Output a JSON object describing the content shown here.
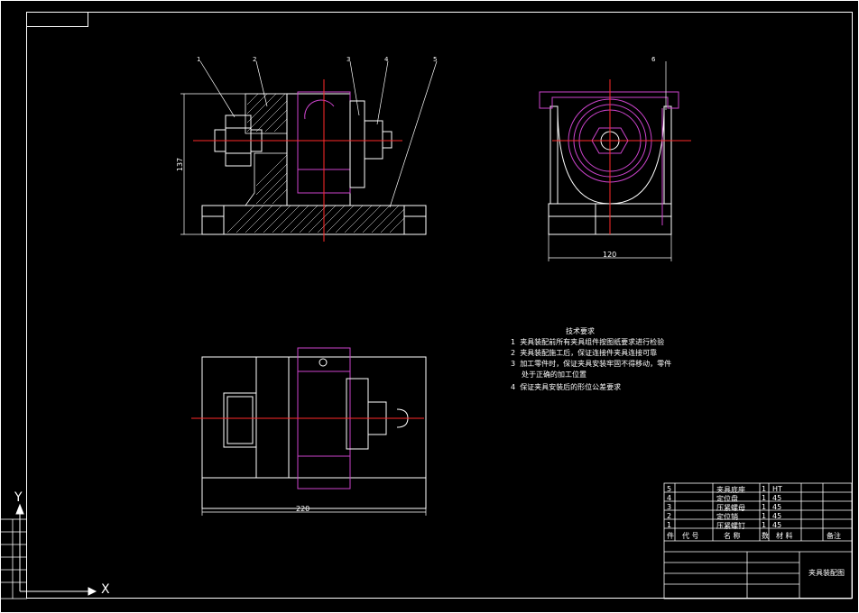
{
  "colors": {
    "background": "#000000",
    "lines": "#ffffff",
    "centerline": "#ff2a2a",
    "part": "#cc44cc"
  },
  "balloons": [
    "1",
    "2",
    "3",
    "4",
    "5",
    "6"
  ],
  "dimensions": {
    "front_height": "137",
    "side_width": "120",
    "top_width": "220"
  },
  "tech_requirements": {
    "title": "技术要求",
    "items": [
      {
        "num": "1",
        "text": "夹具装配前所有夹具组件按图纸要求进行检验"
      },
      {
        "num": "2",
        "text": "夹具装配施工后，保证连接件夹具连接可靠"
      },
      {
        "num": "3",
        "text": "加工零件时，保证夹具安装牢固不得移动，零件"
      },
      {
        "num": "",
        "text": "处于正确的加工位置"
      },
      {
        "num": "4",
        "text": "保证夹具安装后的形位公差要求"
      }
    ]
  },
  "title_block": {
    "header": [
      "件",
      "代 号",
      "名 称",
      "数",
      "材 料",
      "备注"
    ],
    "drawing_name": "夹具装配图",
    "rows": [
      {
        "num": "5",
        "name": "夹具底座",
        "qty": "1",
        "material": "HT"
      },
      {
        "num": "4",
        "name": "定位盘",
        "qty": "1",
        "material": "45"
      },
      {
        "num": "3",
        "name": "压紧螺母",
        "qty": "1",
        "material": "45"
      },
      {
        "num": "2",
        "name": "定位销",
        "qty": "1",
        "material": "45"
      },
      {
        "num": "1",
        "name": "压紧螺钉",
        "qty": "1",
        "material": "45"
      }
    ]
  },
  "axis_labels": {
    "x": "X",
    "y": "Y"
  }
}
